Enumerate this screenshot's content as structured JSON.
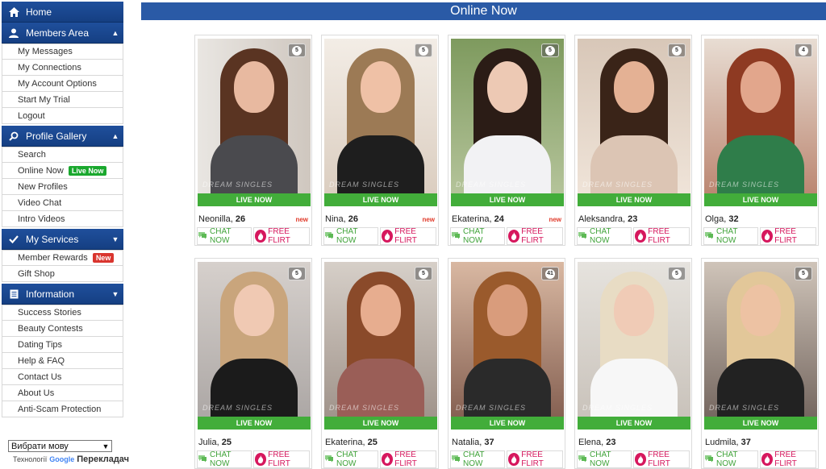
{
  "sidebar": {
    "home": "Home",
    "members_area": {
      "title": "Members Area",
      "items": [
        "My Messages",
        "My Connections",
        "My Account Options",
        "Start My Trial",
        "Logout"
      ]
    },
    "profile_gallery": {
      "title": "Profile Gallery",
      "items": [
        "Search",
        "Online Now",
        "New Profiles",
        "Video Chat",
        "Intro Videos"
      ],
      "live_badge": "Live Now"
    },
    "my_services": {
      "title": "My Services",
      "items": [
        "Member Rewards",
        "Gift Shop"
      ],
      "new_badge": "New"
    },
    "information": {
      "title": "Information",
      "items": [
        "Success Stories",
        "Beauty Contests",
        "Dating Tips",
        "Help & FAQ",
        "Contact Us",
        "About Us",
        "Anti-Scam Protection"
      ]
    }
  },
  "language": {
    "select_value": "Вибрати мову",
    "powered_prefix": "Технології",
    "google": "Google",
    "translator": "Перекладач"
  },
  "header": {
    "title": "Online Now"
  },
  "card_labels": {
    "live": "LIVE NOW",
    "chat": "CHAT NOW",
    "flirt": "FREE FLIRT",
    "new": "new",
    "watermark": "DREAM SINGLES"
  },
  "profiles": [
    {
      "name": "Neonilla",
      "age": "26",
      "photos": "5",
      "is_new": true
    },
    {
      "name": "Nina",
      "age": "26",
      "photos": "5",
      "is_new": true
    },
    {
      "name": "Ekaterina",
      "age": "24",
      "photos": "5",
      "is_new": true
    },
    {
      "name": "Aleksandra",
      "age": "23",
      "photos": "5",
      "is_new": false
    },
    {
      "name": "Olga",
      "age": "32",
      "photos": "4",
      "is_new": false
    },
    {
      "name": "Julia",
      "age": "25",
      "photos": "5",
      "is_new": false
    },
    {
      "name": "Ekaterina",
      "age": "25",
      "photos": "5",
      "is_new": false
    },
    {
      "name": "Natalia",
      "age": "37",
      "photos": "41",
      "is_new": false
    },
    {
      "name": "Elena",
      "age": "23",
      "photos": "5",
      "is_new": false
    },
    {
      "name": "Ludmila",
      "age": "37",
      "photos": "5",
      "is_new": false
    }
  ],
  "colors": {
    "nav_blue": "#1f4f9c",
    "live_green": "#42ad3a",
    "flirt_pink": "#d6175d",
    "new_red": "#e03c2c"
  }
}
